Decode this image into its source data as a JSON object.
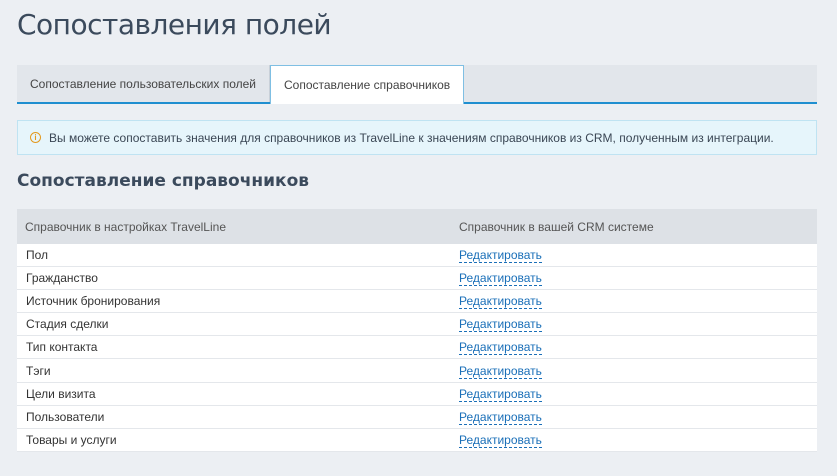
{
  "page": {
    "title": "Сопоставления полей"
  },
  "tabs": [
    {
      "label": "Сопоставление пользовательских полей",
      "active": false
    },
    {
      "label": "Сопоставление справочников",
      "active": true
    }
  ],
  "info": {
    "icon": "info-icon",
    "text": "Вы можете сопоставить значения для справочников из TravelLine к значениям справочников из CRM, полученным из интеграции."
  },
  "section": {
    "title": "Сопоставление справочников"
  },
  "table": {
    "headers": [
      "Справочник в настройках TravelLine",
      "Справочник в вашей CRM системе"
    ],
    "rows": [
      {
        "name": "Пол",
        "action": "Редактировать"
      },
      {
        "name": "Гражданство",
        "action": "Редактировать"
      },
      {
        "name": "Источник бронирования",
        "action": "Редактировать"
      },
      {
        "name": "Стадия сделки",
        "action": "Редактировать"
      },
      {
        "name": "Тип контакта",
        "action": "Редактировать"
      },
      {
        "name": "Тэги",
        "action": "Редактировать"
      },
      {
        "name": "Цели визита",
        "action": "Редактировать"
      },
      {
        "name": "Пользователи",
        "action": "Редактировать"
      },
      {
        "name": "Товары и услуги",
        "action": "Редактировать"
      }
    ]
  },
  "colors": {
    "accent": "#1f8fd0",
    "link": "#1a6fb8",
    "info_bg": "#e6f5fb",
    "info_icon": "#e39a1f"
  }
}
